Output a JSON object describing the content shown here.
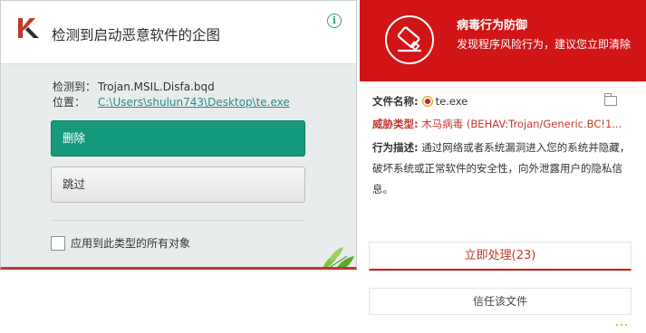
{
  "kaspersky": {
    "title": "检测到启动恶意软件的企图",
    "detected_label": "检测到：",
    "detected_value": "Trojan.MSIL.Disfa.bqd",
    "location_label": "位置：",
    "location_value": "C:\\Users\\shulun743\\Desktop\\te.exe",
    "delete_label": "删除",
    "skip_label": "跳过",
    "apply_all_label": "应用到此类型的所有对象",
    "icons": {
      "logo": "kaspersky-k-logo",
      "info": "info-icon",
      "decoration": "leaves-icon"
    },
    "colors": {
      "accent": "#159a7d",
      "bottom_bar": "#c0392b"
    }
  },
  "alert": {
    "title": "病毒行为防御",
    "subtitle": "发现程序风险行为，建议您立即清除",
    "file_label": "文件名称:",
    "file_value": "te.exe",
    "threat_label": "威胁类型:",
    "threat_value": "木马病毒 (BEHAV:Trojan/Generic.BC!1...",
    "desc_label": "行为描述:",
    "desc_text": "通过网络或者系统漏洞进入您的系统并隐藏，破坏系统或正常软件的安全性，向外泄露用户的隐私信息。",
    "handle_label": "立即处理(23)",
    "trust_label": "信任该文件",
    "icons": {
      "header": "shield-device-icon",
      "file": "file-icon",
      "folder": "folder-icon"
    },
    "colors": {
      "header_bg": "#d11517",
      "threat_text": "#c0392b"
    }
  }
}
